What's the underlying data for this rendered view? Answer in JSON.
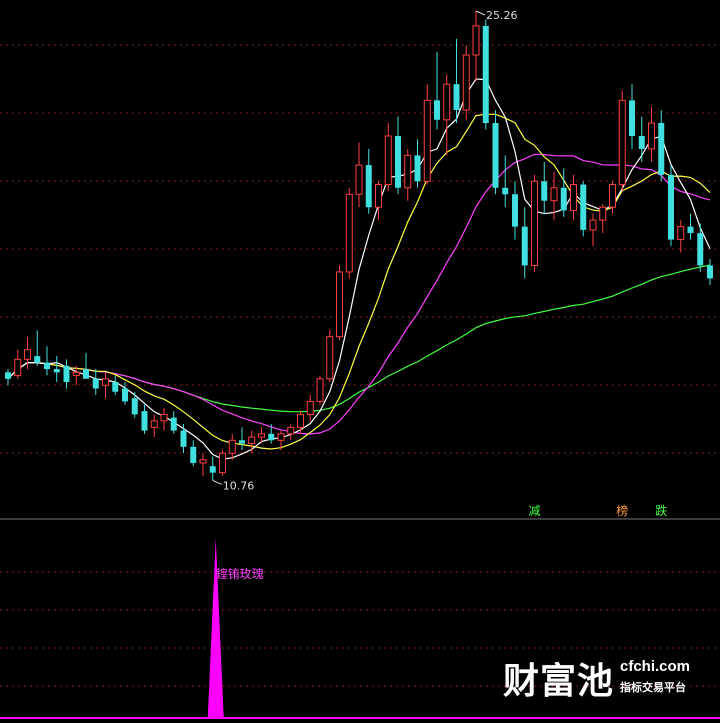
{
  "chart_data": [
    {
      "type": "candlestick",
      "price_max_label": "25.26",
      "price_min_label": "10.76",
      "y_top": 25.6,
      "y_bottom": 9.6,
      "colors": {
        "up": "#ff4040",
        "down": "#40e0e0",
        "ma5": "#ffffff",
        "ma10": "#ffff40",
        "ma20": "#ff40ff",
        "ma60": "#40ff40",
        "grid": "#8a1a1a",
        "max_label": "#dddddd"
      },
      "candles": [
        [
          14.1,
          14.2,
          13.7,
          13.9
        ],
        [
          14.0,
          14.8,
          13.9,
          14.5
        ],
        [
          14.5,
          15.2,
          14.2,
          14.8
        ],
        [
          14.6,
          15.4,
          14.3,
          14.4
        ],
        [
          14.4,
          14.9,
          14.0,
          14.2
        ],
        [
          14.2,
          14.6,
          13.8,
          14.1
        ],
        [
          14.3,
          14.5,
          13.6,
          13.8
        ],
        [
          14.0,
          14.3,
          13.7,
          14.1
        ],
        [
          14.2,
          14.7,
          13.9,
          13.9
        ],
        [
          13.9,
          14.2,
          13.4,
          13.6
        ],
        [
          13.7,
          14.1,
          13.3,
          13.9
        ],
        [
          13.8,
          14.0,
          13.4,
          13.5
        ],
        [
          13.6,
          13.8,
          13.1,
          13.2
        ],
        [
          13.3,
          13.5,
          12.7,
          12.8
        ],
        [
          12.9,
          13.1,
          12.2,
          12.3
        ],
        [
          12.4,
          12.8,
          12.1,
          12.6
        ],
        [
          12.6,
          13.0,
          12.3,
          12.8
        ],
        [
          12.7,
          12.9,
          12.2,
          12.3
        ],
        [
          12.3,
          12.5,
          11.6,
          11.8
        ],
        [
          11.8,
          12.0,
          11.2,
          11.3
        ],
        [
          11.3,
          11.6,
          10.9,
          11.4
        ],
        [
          11.2,
          11.5,
          10.76,
          11.0
        ],
        [
          11.0,
          11.7,
          10.9,
          11.6
        ],
        [
          11.6,
          12.2,
          11.4,
          12.0
        ],
        [
          12.0,
          12.4,
          11.7,
          11.9
        ],
        [
          11.9,
          12.3,
          11.6,
          12.1
        ],
        [
          12.1,
          12.4,
          11.9,
          12.2
        ],
        [
          12.2,
          12.5,
          11.9,
          12.0
        ],
        [
          12.0,
          12.3,
          11.7,
          12.2
        ],
        [
          12.2,
          12.5,
          12.0,
          12.4
        ],
        [
          12.4,
          12.9,
          12.2,
          12.8
        ],
        [
          12.8,
          13.4,
          12.6,
          13.2
        ],
        [
          13.2,
          14.0,
          13.1,
          13.9
        ],
        [
          13.9,
          15.4,
          13.8,
          15.2
        ],
        [
          15.2,
          17.4,
          15.1,
          17.2
        ],
        [
          17.2,
          19.8,
          17.0,
          19.6
        ],
        [
          19.6,
          21.2,
          19.2,
          20.5
        ],
        [
          20.5,
          21.0,
          19.0,
          19.2
        ],
        [
          19.2,
          20.0,
          18.8,
          19.9
        ],
        [
          19.9,
          21.8,
          19.7,
          21.4
        ],
        [
          21.4,
          22.0,
          19.6,
          19.8
        ],
        [
          19.8,
          21.0,
          19.4,
          20.8
        ],
        [
          20.8,
          21.3,
          19.8,
          20.0
        ],
        [
          20.0,
          23.0,
          19.9,
          22.5
        ],
        [
          22.5,
          24.0,
          21.6,
          21.9
        ],
        [
          21.9,
          23.3,
          20.8,
          23.0
        ],
        [
          23.0,
          24.4,
          21.8,
          22.2
        ],
        [
          22.2,
          24.2,
          21.9,
          23.9
        ],
        [
          23.9,
          25.26,
          23.1,
          24.8
        ],
        [
          24.8,
          25.0,
          21.6,
          21.8
        ],
        [
          21.8,
          22.2,
          19.6,
          19.8
        ],
        [
          19.8,
          20.8,
          19.2,
          19.6
        ],
        [
          19.6,
          20.0,
          18.2,
          18.6
        ],
        [
          18.6,
          19.2,
          17.0,
          17.4
        ],
        [
          17.4,
          20.2,
          17.2,
          20.0
        ],
        [
          20.0,
          20.6,
          19.0,
          19.4
        ],
        [
          19.4,
          20.3,
          18.8,
          19.8
        ],
        [
          19.8,
          20.4,
          18.9,
          19.1
        ],
        [
          19.1,
          20.2,
          18.8,
          19.9
        ],
        [
          19.9,
          20.0,
          18.3,
          18.5
        ],
        [
          18.5,
          19.0,
          18.0,
          18.8
        ],
        [
          18.8,
          19.3,
          18.4,
          19.2
        ],
        [
          19.2,
          20.0,
          19.0,
          19.9
        ],
        [
          19.9,
          22.8,
          19.7,
          22.5
        ],
        [
          22.5,
          23.0,
          21.0,
          21.4
        ],
        [
          21.4,
          22.0,
          20.6,
          21.0
        ],
        [
          21.0,
          22.3,
          20.6,
          21.8
        ],
        [
          21.8,
          22.2,
          20.0,
          20.2
        ],
        [
          20.2,
          20.5,
          18.0,
          18.2
        ],
        [
          18.2,
          18.8,
          17.8,
          18.6
        ],
        [
          18.6,
          19.0,
          18.2,
          18.4
        ],
        [
          18.4,
          18.7,
          17.2,
          17.4
        ],
        [
          17.4,
          17.6,
          16.8,
          17.0
        ]
      ],
      "signals": [
        {
          "index": 54,
          "text": "减",
          "color": "#40ff40"
        },
        {
          "index": 63,
          "text": "榜",
          "color": "#ff9a3c"
        },
        {
          "index": 67,
          "text": "跌",
          "color": "#40ff40"
        }
      ]
    },
    {
      "type": "bar",
      "signal_index": 21,
      "label": "鍠铕玫瑰",
      "label_color": "#ff40ff",
      "value": 1
    }
  ],
  "watermark": {
    "brand": "财富池",
    "url": "cfchi.com",
    "tagline": "指标交易平台"
  }
}
